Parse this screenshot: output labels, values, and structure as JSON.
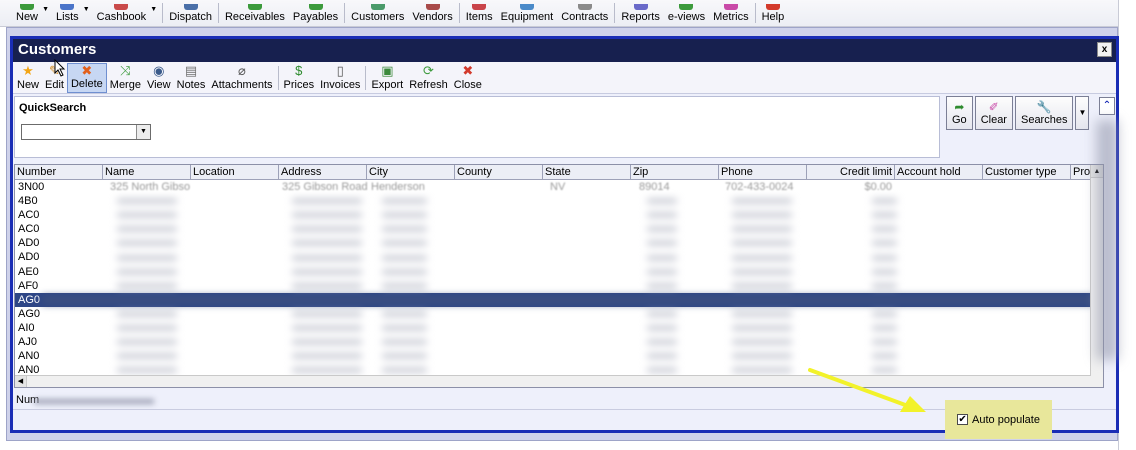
{
  "app_toolbar": {
    "items": [
      {
        "label": "New",
        "icon": "new-icon",
        "color": "#3c9a3c",
        "caret": true
      },
      {
        "label": "Lists",
        "icon": "lists-icon",
        "color": "#4a74c9",
        "caret": true
      },
      {
        "label": "Cashbook",
        "icon": "cashbook-icon",
        "color": "#c94a4a",
        "caret": true
      },
      {
        "label": "Dispatch",
        "icon": "dispatch-icon",
        "color": "#4a6fa8",
        "caret": false
      },
      {
        "label": "Receivables",
        "icon": "receivables-icon",
        "color": "#3c9a3c",
        "caret": false
      },
      {
        "label": "Payables",
        "icon": "payables-icon",
        "color": "#3c9a3c",
        "caret": false
      },
      {
        "label": "Customers",
        "icon": "customers-icon",
        "color": "#4a9a6a",
        "caret": false
      },
      {
        "label": "Vendors",
        "icon": "vendors-icon",
        "color": "#a84a4a",
        "caret": false
      },
      {
        "label": "Items",
        "icon": "items-icon",
        "color": "#c9444a",
        "caret": false
      },
      {
        "label": "Equipment",
        "icon": "equipment-icon",
        "color": "#4a8ac9",
        "caret": false
      },
      {
        "label": "Contracts",
        "icon": "contracts-icon",
        "color": "#8a8a8a",
        "caret": false
      },
      {
        "label": "Reports",
        "icon": "reports-icon",
        "color": "#6a6ac9",
        "caret": false
      },
      {
        "label": "e-views",
        "icon": "eviews-icon",
        "color": "#3c9a3c",
        "caret": false
      },
      {
        "label": "Metrics",
        "icon": "metrics-icon",
        "color": "#c94aa8",
        "caret": false
      },
      {
        "label": "Help",
        "icon": "help-icon",
        "color": "#d33a2c",
        "caret": false
      }
    ]
  },
  "window": {
    "title": "Customers",
    "close_label": "x",
    "toolbar": [
      {
        "label": "New",
        "icon": "star-icon",
        "glyph": "★",
        "color": "#f2a516",
        "active": false
      },
      {
        "label": "Edit",
        "icon": "pencil-icon",
        "glyph": "✎",
        "color": "#d08a1c",
        "active": false
      },
      {
        "label": "Delete",
        "icon": "delete-x-icon",
        "glyph": "✖",
        "color": "#e2601c",
        "active": true
      },
      {
        "label": "Merge",
        "icon": "merge-icon",
        "glyph": "⤨",
        "color": "#3c9a3c",
        "active": false
      },
      {
        "label": "View",
        "icon": "binoculars-icon",
        "glyph": "◉",
        "color": "#3a5a8a",
        "active": false
      },
      {
        "label": "Notes",
        "icon": "notes-icon",
        "glyph": "▤",
        "color": "#707070",
        "active": false
      },
      {
        "label": "Attachments",
        "icon": "paperclip-icon",
        "glyph": "⌀",
        "color": "#555555",
        "active": false
      },
      {
        "label": "Prices",
        "icon": "dollar-icon",
        "glyph": "$",
        "color": "#2e8b2e",
        "active": false
      },
      {
        "label": "Invoices",
        "icon": "invoice-icon",
        "glyph": "▯",
        "color": "#555555",
        "active": false
      },
      {
        "label": "Export",
        "icon": "export-icon",
        "glyph": "▣",
        "color": "#3c8a3c",
        "active": false
      },
      {
        "label": "Refresh",
        "icon": "refresh-icon",
        "glyph": "⟳",
        "color": "#3c9a3c",
        "active": false
      },
      {
        "label": "Close",
        "icon": "close-circle-icon",
        "glyph": "✖",
        "color": "#d33a2c",
        "active": false
      }
    ]
  },
  "quicksearch": {
    "label": "QuickSearch",
    "buttons": [
      {
        "label": "Go",
        "icon": "go-arrow-icon",
        "glyph": "➦",
        "color": "#2e8b2e"
      },
      {
        "label": "Clear",
        "icon": "eraser-icon",
        "glyph": "✐",
        "color": "#c94aa8"
      },
      {
        "label": "Searches",
        "icon": "wrench-icon",
        "glyph": "🔧",
        "color": "#3a6ac9"
      }
    ],
    "collapse_glyph": "⌃"
  },
  "grid": {
    "columns": [
      {
        "label": "Number",
        "align": "left"
      },
      {
        "label": "Name",
        "align": "left"
      },
      {
        "label": "Location",
        "align": "left"
      },
      {
        "label": "Address",
        "align": "left"
      },
      {
        "label": "City",
        "align": "left"
      },
      {
        "label": "County",
        "align": "left"
      },
      {
        "label": "State",
        "align": "left"
      },
      {
        "label": "Zip",
        "align": "left"
      },
      {
        "label": "Phone",
        "align": "left"
      },
      {
        "label": "Credit limit",
        "align": "right"
      },
      {
        "label": "Account hold",
        "align": "left"
      },
      {
        "label": "Customer type",
        "align": "left"
      },
      {
        "label": "Prospec",
        "align": "left"
      }
    ],
    "rows": [
      {
        "number": "3N00",
        "name": "325 North Gibso",
        "address": "325 Gibson Road",
        "city": "Henderson",
        "state": "NV",
        "zip": "89014",
        "phone": "702-433-0024",
        "credit": "$0.00",
        "selected": false
      },
      {
        "number": "4B0",
        "selected": false
      },
      {
        "number": "AC0",
        "selected": false
      },
      {
        "number": "AC0",
        "selected": false
      },
      {
        "number": "AD0",
        "selected": false
      },
      {
        "number": "AD0",
        "selected": false
      },
      {
        "number": "AE0",
        "selected": false
      },
      {
        "number": "AF0",
        "selected": false
      },
      {
        "number": "AG0",
        "selected": true
      },
      {
        "number": "AG0",
        "selected": false
      },
      {
        "number": "AI0",
        "selected": false
      },
      {
        "number": "AJ0",
        "selected": false
      },
      {
        "number": "AN0",
        "selected": false
      },
      {
        "number": "AN0",
        "selected": false
      }
    ]
  },
  "footer": {
    "num_customers_label": "Num"
  },
  "auto_populate": {
    "label": "Auto populate",
    "checked": true,
    "check_glyph": "✔"
  },
  "colors": {
    "title_bar": "#17204f",
    "window_border": "#1a2db5",
    "highlight": "#e8e79b",
    "annotation_arrow": "#f2f22a",
    "selected_row": "#2e4686"
  }
}
